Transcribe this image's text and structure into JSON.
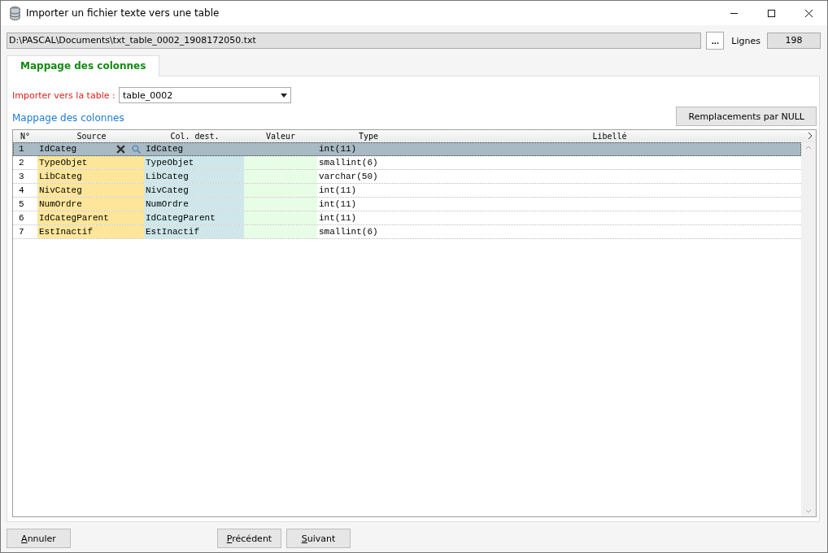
{
  "window": {
    "title": "Importer un fichier texte vers une table"
  },
  "file": {
    "path": "D:\\PASCAL\\Documents\\txt_table_0002_1908172050.txt",
    "browse": "...",
    "lines_label": "Lignes",
    "lines_value": "198"
  },
  "tabs": [
    {
      "label": "Mappage des colonnes",
      "selected": true
    }
  ],
  "target": {
    "label": "Importer vers la table :",
    "value": "table_0002"
  },
  "section_title": "Mappage des colonnes",
  "null_button": "Remplacements par NULL",
  "table": {
    "columns": [
      "N°",
      "Source",
      "Col. dest.",
      "Valeur",
      "Type",
      "Libellé"
    ],
    "rows": [
      {
        "n": "1",
        "source": "IdCateg",
        "dest": "IdCateg",
        "type": "int(11)",
        "selected": true
      },
      {
        "n": "2",
        "source": "TypeObjet",
        "dest": "TypeObjet",
        "type": "smallint(6)",
        "selected": false
      },
      {
        "n": "3",
        "source": "LibCateg",
        "dest": "LibCateg",
        "type": "varchar(50)",
        "selected": false
      },
      {
        "n": "4",
        "source": "NivCateg",
        "dest": "NivCateg",
        "type": "int(11)",
        "selected": false
      },
      {
        "n": "5",
        "source": "NumOrdre",
        "dest": "NumOrdre",
        "type": "int(11)",
        "selected": false
      },
      {
        "n": "6",
        "source": "IdCategParent",
        "dest": "IdCategParent",
        "type": "int(11)",
        "selected": false
      },
      {
        "n": "7",
        "source": "EstInactif",
        "dest": "EstInactif",
        "type": "smallint(6)",
        "selected": false
      }
    ]
  },
  "buttons": {
    "cancel": "Annuler",
    "previous": "Précédent",
    "next": "Suivant"
  }
}
